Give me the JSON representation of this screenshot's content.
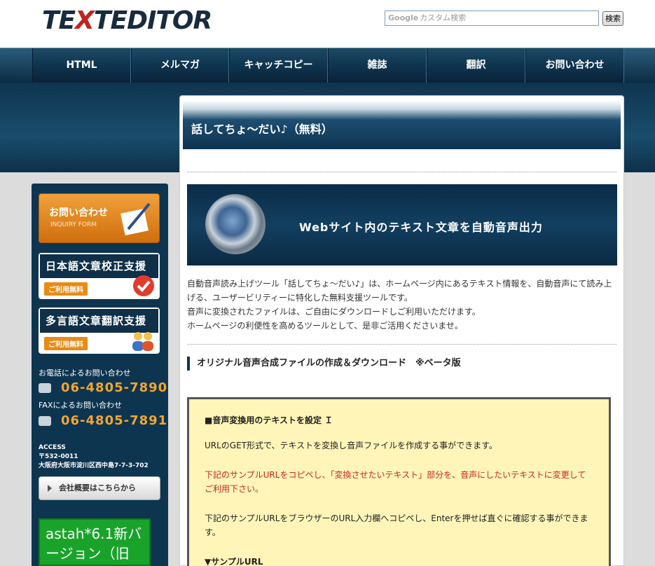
{
  "header": {
    "logo_part1": "TE",
    "logo_x": "X",
    "logo_part2": "TEDITOR",
    "search_brand": "Google",
    "search_placeholder": "カスタム検索",
    "search_button": "検索"
  },
  "nav": {
    "items": [
      {
        "label": "HTML"
      },
      {
        "label": "メルマガ"
      },
      {
        "label": "キャッチコピー"
      },
      {
        "label": "雑誌"
      },
      {
        "label": "翻訳"
      },
      {
        "label": "お問い合わせ"
      }
    ]
  },
  "sidebar": {
    "inquiry_title": "お問い合わせ",
    "inquiry_sub": "INQUIRY FORM",
    "proofread_title": "日本語文章校正支援",
    "proofread_tag": "ご利用無料",
    "translate_title": "多言語文章翻訳支援",
    "translate_tag": "ご利用無料",
    "phone_label": "お電話によるお問い合わせ",
    "phone_number": "06-4805-7890",
    "fax_label": "FAXによるお問い合わせ",
    "fax_number": "06-4805-7891",
    "access_label": "ACCESS",
    "postal": "〒532-0011",
    "address": "大阪府大阪市淀川区西中島7-7-3-702",
    "company_button": "会社概要はこちらから",
    "ad_text": "astah*6.1新バージョン（旧"
  },
  "main": {
    "title": "話してちょ〜だい♪（無料）",
    "hero_text": "Webサイト内のテキスト文章を自動音声出力",
    "description": [
      "自動音声読み上げツール「話してちょ〜だい♪」は、ホームページ内にあるテキスト情報を、自動音声にて読み上",
      "げる、ユーザービリティーに特化した無料支援ツールです。",
      "音声に変換されたファイルは、ご自由にダウンロードしご利用いただけます。",
      "ホームページの利便性を高めるツールとして、是非ご活用くださいませ。"
    ],
    "section_heading": "オリジナル音声合成ファイルの作成＆ダウンロード　※ベータ版",
    "box": {
      "heading": "■音声変換用のテキストを設定 Ｉ",
      "line1": "URLのGET形式で、テキストを変換し音声ファイルを作成する事ができます。",
      "red_line1": "下記のサンプルURLをコピペし、「変換させたいテキスト」部分を、音声にしたいテキストに変更して",
      "red_line2": "ご利用下さい。",
      "line2a": "下記のサンプルURLをブラウザーのURL入力欄へコピペし、Enterを押せば直ぐに確認する事ができま",
      "line2b": "す。",
      "sample_heading": "▼サンプルURL"
    }
  }
}
